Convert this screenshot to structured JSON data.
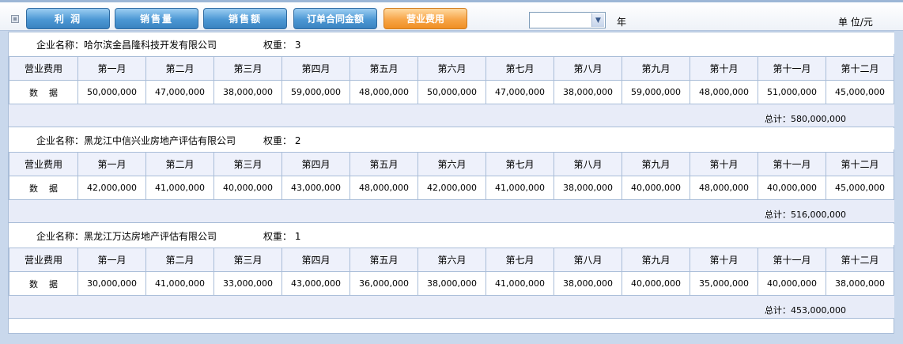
{
  "toolbar": {
    "tabs": [
      {
        "label": "利  润",
        "active": false
      },
      {
        "label": "销售量",
        "active": false
      },
      {
        "label": "销售额",
        "active": false
      },
      {
        "label": "订单合同金额",
        "active": false
      },
      {
        "label": "营业费用",
        "active": true
      }
    ],
    "year_select_value": "",
    "year_label": "年",
    "unit_label": "单 位/元"
  },
  "columns": {
    "first_header": "营业费用",
    "months": [
      "第一月",
      "第二月",
      "第三月",
      "第四月",
      "第五月",
      "第六月",
      "第七月",
      "第八月",
      "第九月",
      "第十月",
      "第十一月",
      "第十二月"
    ],
    "row_label": "数    据"
  },
  "companies": [
    {
      "name": "企业名称：哈尔滨金昌隆科技开发有限公司",
      "weight": "权重： 3",
      "values": [
        "50,000,000",
        "47,000,000",
        "38,000,000",
        "59,000,000",
        "48,000,000",
        "50,000,000",
        "47,000,000",
        "38,000,000",
        "59,000,000",
        "48,000,000",
        "51,000,000",
        "45,000,000"
      ],
      "total": "总计：580,000,000"
    },
    {
      "name": "企业名称：黑龙江中信兴业房地产评估有限公司",
      "weight": "权重： 2",
      "values": [
        "42,000,000",
        "41,000,000",
        "40,000,000",
        "43,000,000",
        "48,000,000",
        "42,000,000",
        "41,000,000",
        "38,000,000",
        "40,000,000",
        "48,000,000",
        "40,000,000",
        "45,000,000"
      ],
      "total": "总计：516,000,000"
    },
    {
      "name": "企业名称：黑龙江万达房地产评估有限公司",
      "weight": "权重： 1",
      "values": [
        "30,000,000",
        "41,000,000",
        "33,000,000",
        "43,000,000",
        "36,000,000",
        "38,000,000",
        "41,000,000",
        "38,000,000",
        "40,000,000",
        "35,000,000",
        "40,000,000",
        "38,000,000"
      ],
      "total": "总计：453,000,000"
    }
  ],
  "colors": {
    "tab_blue": "#4c98d4",
    "tab_active_orange": "#f7a548",
    "header_row_bg": "#eef1fb",
    "total_row_bg": "#e8ecf8",
    "border": "#a9bdd8"
  }
}
